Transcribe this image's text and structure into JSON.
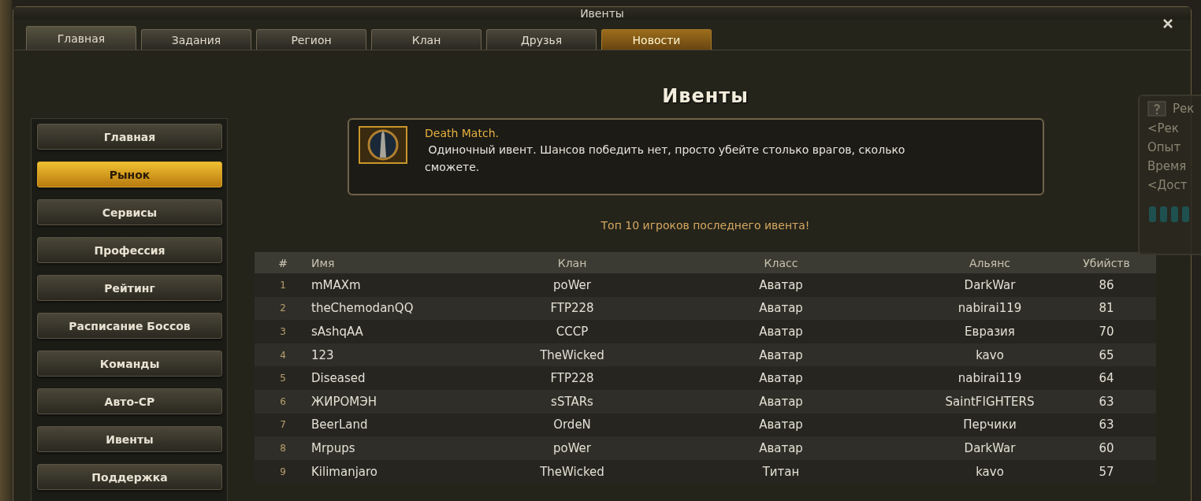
{
  "window": {
    "title": "Ивенты"
  },
  "tabs": [
    {
      "label": "Главная",
      "selected": true,
      "highlighted": false
    },
    {
      "label": "Задания",
      "selected": false,
      "highlighted": false
    },
    {
      "label": "Регион",
      "selected": false,
      "highlighted": false
    },
    {
      "label": "Клан",
      "selected": false,
      "highlighted": false
    },
    {
      "label": "Друзья",
      "selected": false,
      "highlighted": false
    },
    {
      "label": "Новости",
      "selected": false,
      "highlighted": true
    }
  ],
  "sidebar": {
    "items": [
      {
        "label": "Главная",
        "highlighted": false
      },
      {
        "label": "Рынок",
        "highlighted": true
      },
      {
        "label": "Сервисы",
        "highlighted": false
      },
      {
        "label": "Профессия",
        "highlighted": false
      },
      {
        "label": "Рейтинг",
        "highlighted": false
      },
      {
        "label": "Расписание Боссов",
        "highlighted": false
      },
      {
        "label": "Команды",
        "highlighted": false
      },
      {
        "label": "Авто-СР",
        "highlighted": false
      },
      {
        "label": "Ивенты",
        "highlighted": false
      },
      {
        "label": "Поддержка",
        "highlighted": false
      }
    ]
  },
  "page_title": "Ивенты",
  "event": {
    "name": "Death Match.",
    "description": " Одиночный ивент. Шансов победить нет, просто убейте столько врагов, сколько сможете."
  },
  "subtitle": "Топ 10 игроков последнего ивента!",
  "table": {
    "columns": [
      "#",
      "Имя",
      "Клан",
      "Класс",
      "Альянс",
      "Убийств"
    ],
    "rows": [
      [
        "1",
        "mMAXm",
        "poWer",
        "Аватар",
        "DarkWar",
        "86"
      ],
      [
        "2",
        "theChemodanQQ",
        "FTP228",
        "Аватар",
        "nabirai119",
        "81"
      ],
      [
        "3",
        "sAshqAA",
        "СССР",
        "Аватар",
        "Евразия",
        "70"
      ],
      [
        "4",
        "123",
        "TheWicked",
        "Аватар",
        "kavo",
        "65"
      ],
      [
        "5",
        "Diseased",
        "FTP228",
        "Аватар",
        "nabirai119",
        "64"
      ],
      [
        "6",
        "ЖИРОМЭН",
        "sSTARs",
        "Аватар",
        "SaintFIGHTERS",
        "63"
      ],
      [
        "7",
        "BeerLand",
        "OrdeN",
        "Аватар",
        "Перчики",
        "63"
      ],
      [
        "8",
        "Mrpups",
        "poWer",
        "Аватар",
        "DarkWar",
        "60"
      ],
      [
        "9",
        "Kilimanjaro",
        "TheWicked",
        "Титан",
        "kavo",
        "57"
      ]
    ]
  },
  "side_panel": {
    "title": "Рек",
    "lines": [
      "<Рек",
      "Опыт",
      "Время",
      "<Дост"
    ]
  }
}
